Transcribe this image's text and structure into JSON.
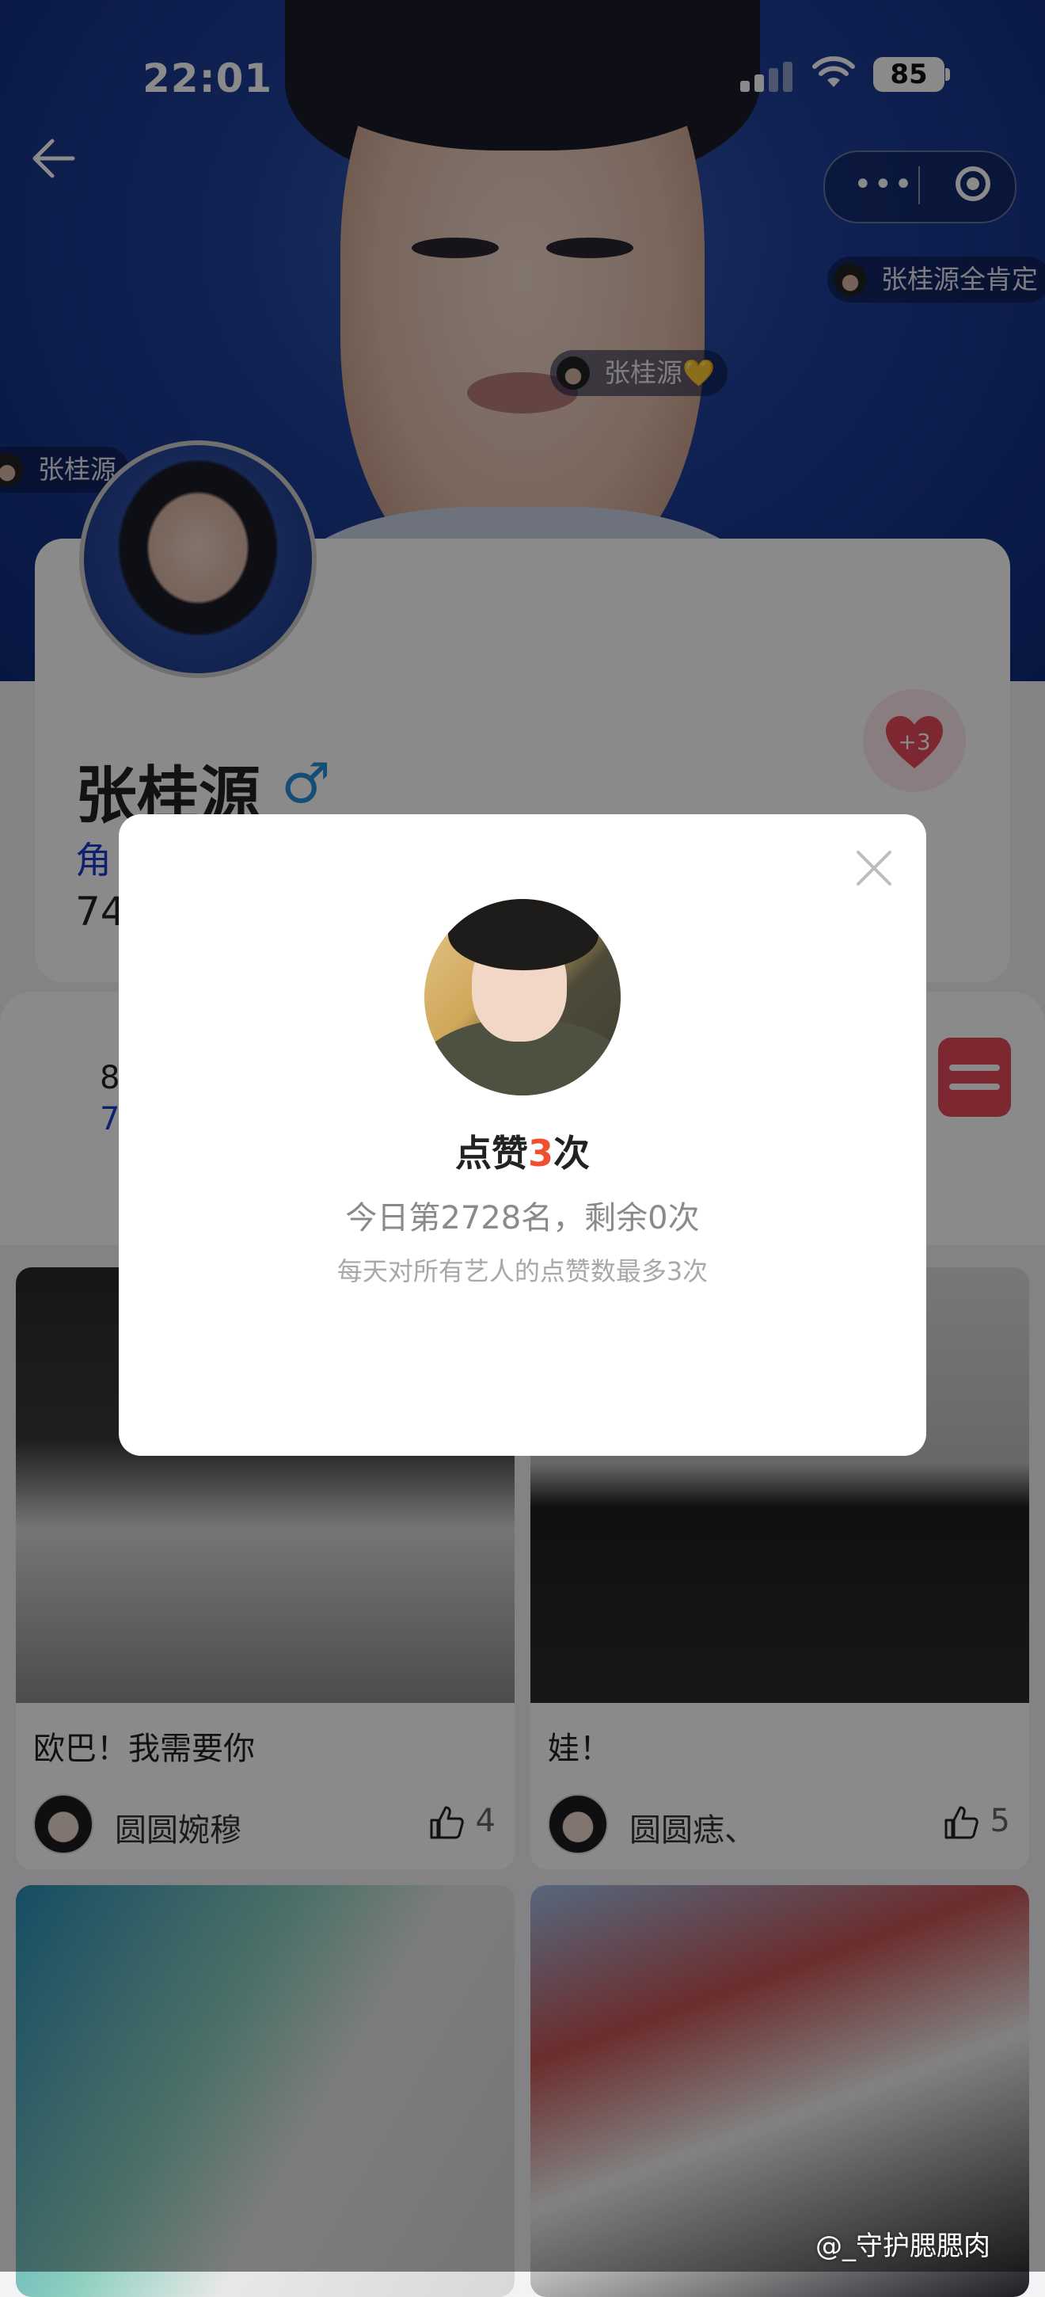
{
  "status_bar": {
    "time": "22:01",
    "battery": "85"
  },
  "danmaku": [
    {
      "text": "张桂源全肯定"
    },
    {
      "text": "张桂源💛"
    },
    {
      "text": "张桂源"
    }
  ],
  "profile": {
    "name": "张桂源",
    "gender_symbol": "♂",
    "role_text_visible": "角",
    "count_visible": "74",
    "like_badge": "+3"
  },
  "stats_strip": {
    "line1": "8",
    "line2": "7"
  },
  "posts": [
    {
      "title": "欧巴！我需要你",
      "user": "圆圆婉穆",
      "likes": "4"
    },
    {
      "title": "娃！",
      "user": "圆圆痣、",
      "likes": "5"
    }
  ],
  "modal": {
    "title_prefix": "点赞",
    "title_count": "3",
    "title_suffix": "次",
    "subtitle": "今日第2728名，剩余0次",
    "note": "每天对所有艺人的点赞数最多3次"
  },
  "watermark": "@_守护腮腮肉",
  "colors": {
    "accent_red": "#f0502e",
    "role_blue": "#1d3ccf",
    "gender_blue": "#2a8fd6"
  }
}
